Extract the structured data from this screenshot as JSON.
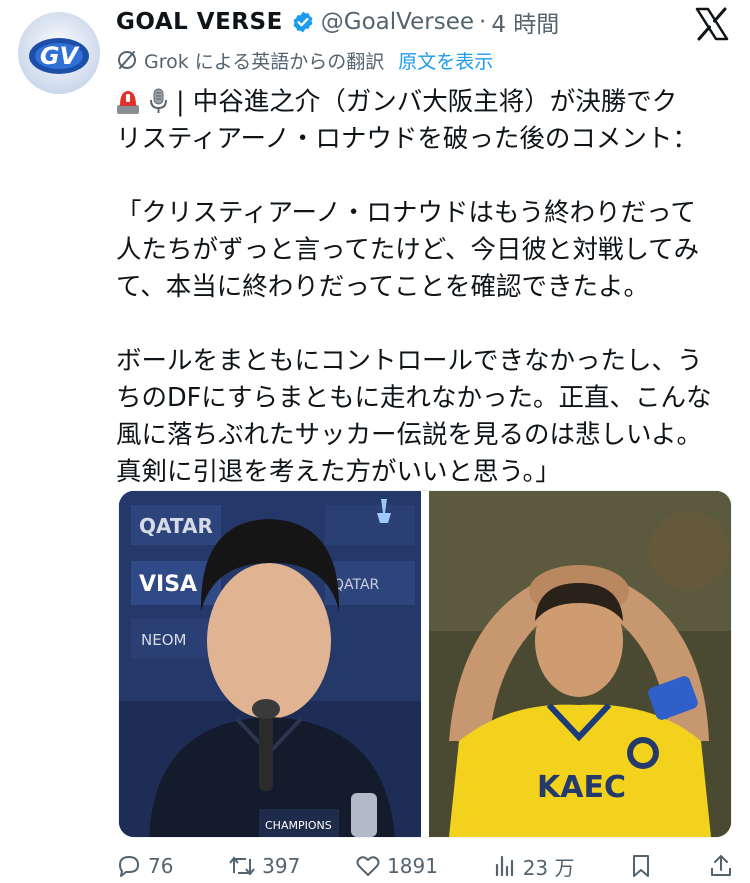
{
  "author": {
    "display_name": "GOAL VERSE",
    "handle": "@GoalVersee",
    "time": "4 時間",
    "avatar_text": "GV",
    "verified_icon": "verified-badge-icon"
  },
  "translation": {
    "text": "Grok による英語からの翻訳",
    "link": "原文を表示"
  },
  "tweet": {
    "line1": "| 中谷進之介（ガンバ大阪主将）が決勝でク",
    "line2": "リスティアーノ・ロナウドを破った後のコメント：",
    "quote": "「クリスティアーノ・ロナウドはもう終わりだって\n人たちがずっと言ってたけど、今日彼と対戦してみ\nて、本当に終わりだってことを確認できたよ。\n\nボールをまともにコントロールできなかったし、う\nちのDFにすらまともに走れなかった。正直、こんな\n風に落ちぶれたサッカー伝説を見るのは悲しいよ。\n真剣に引退を考えた方がいいと思う。」"
  },
  "media": {
    "left_banner": [
      "QATAR",
      "VISA",
      "NEOM",
      "QATAR",
      "CHAMPIONS"
    ],
    "right_jersey": "KAEC"
  },
  "actions": {
    "replies": "76",
    "reposts": "397",
    "likes": "1891",
    "views": "23 万"
  },
  "colors": {
    "text": "#0f1419",
    "secondary": "#536471",
    "link": "#1d9bf0",
    "verified": "#1d9bf0"
  }
}
